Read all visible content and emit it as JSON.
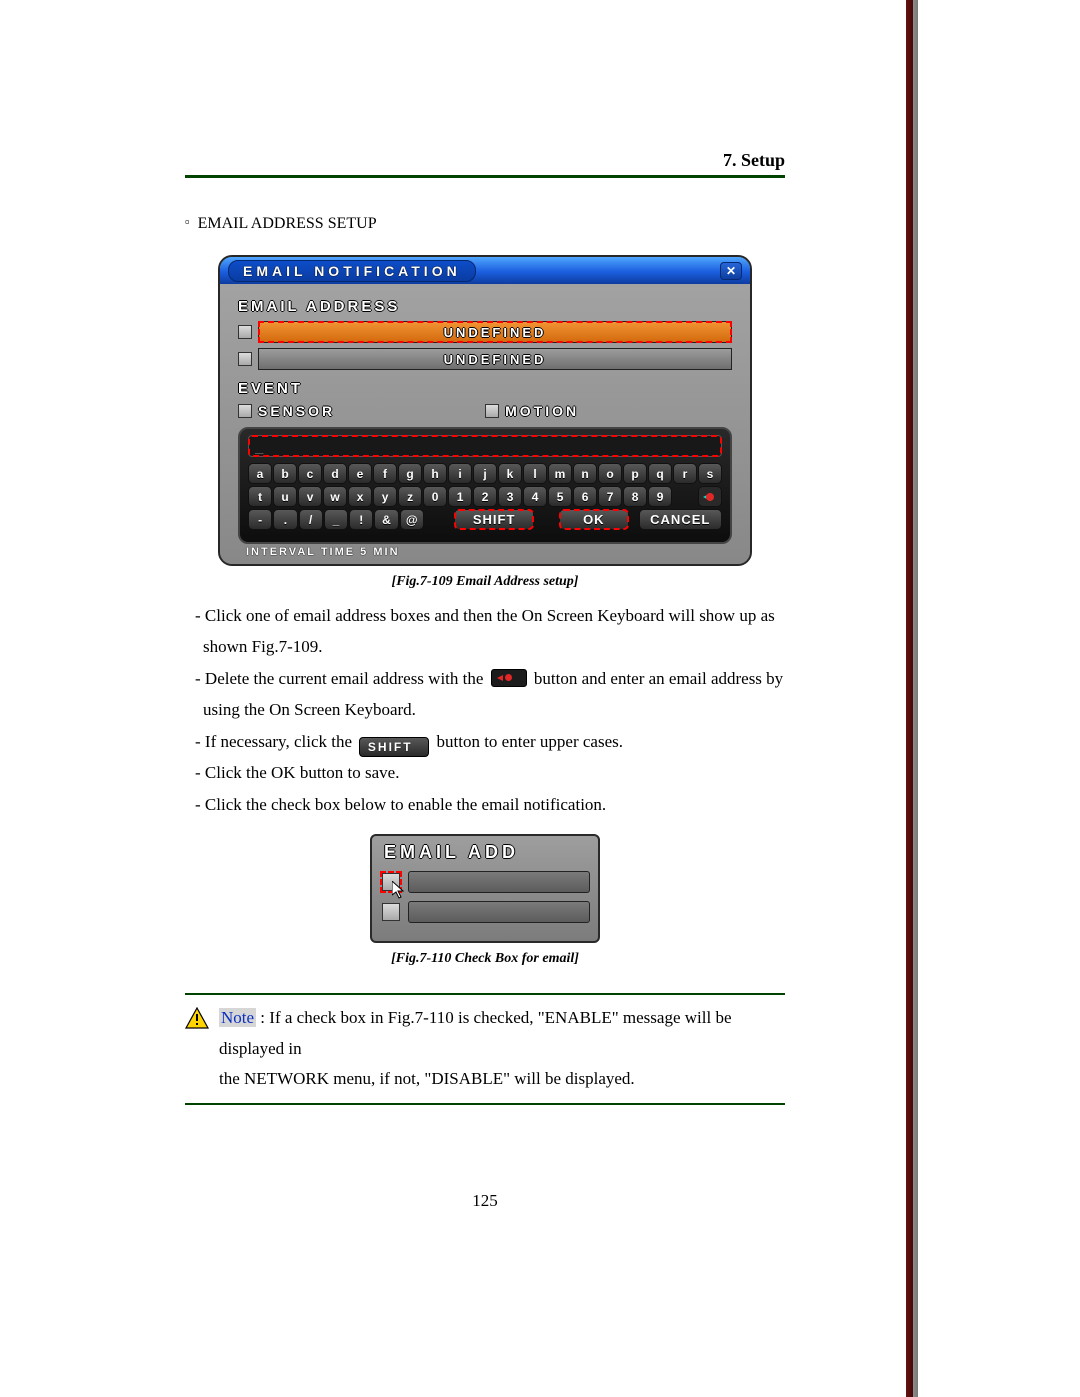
{
  "header": {
    "title": "7. Setup"
  },
  "section_title": "EMAIL ADDRESS SETUP",
  "figure1": {
    "titlebar": "EMAIL NOTIFICATION",
    "close_x": "✕",
    "email_address_label": "EMAIL ADDRESS",
    "addr1": "UNDEFINED",
    "addr2": "UNDEFINED",
    "event_label": "EVENT",
    "sensor_label": "SENSOR",
    "motion_label": "MOTION",
    "display_value": "_",
    "row1": [
      "a",
      "b",
      "c",
      "d",
      "e",
      "f",
      "g",
      "h",
      "i",
      "j",
      "k",
      "l",
      "m",
      "n",
      "o",
      "p",
      "q",
      "r",
      "s"
    ],
    "row2": [
      "t",
      "u",
      "v",
      "w",
      "x",
      "y",
      "z",
      "0",
      "1",
      "2",
      "3",
      "4",
      "5",
      "6",
      "7",
      "8",
      "9"
    ],
    "row3_sym": [
      "-",
      ".",
      "/",
      "_",
      "!",
      "&",
      "@"
    ],
    "shift": "SHIFT",
    "ok": "OK",
    "cancel": "CANCEL",
    "cutrow": "INTERVAL   TIME        5      MIN",
    "caption": "[Fig.7-109 Email Address setup]"
  },
  "body": {
    "p1a": "- Click one of email address boxes and then the On Screen Keyboard will show up as",
    "p1b": "shown Fig.7-109.",
    "p2a": "- Delete the current email address with the",
    "p2b": "button and enter an email address by",
    "p2c": "using the On Screen Keyboard.",
    "p3a": "- If necessary, click the",
    "p3b": "button to enter upper cases.",
    "p4": "- Click the OK button to save.",
    "p5": "- Click the check box below to enable the email notification.",
    "inline_shift": "SHIFT"
  },
  "figure2": {
    "label": "EMAIL ADD",
    "caption": "[Fig.7-110 Check Box for email]"
  },
  "note": {
    "label": "Note",
    "colon": " : ",
    "line1": "If a check box in Fig.7-110 is checked, \"ENABLE\" message will be displayed in",
    "line2": "the NETWORK menu, if not, \"DISABLE\" will be displayed."
  },
  "pagenum": "125"
}
